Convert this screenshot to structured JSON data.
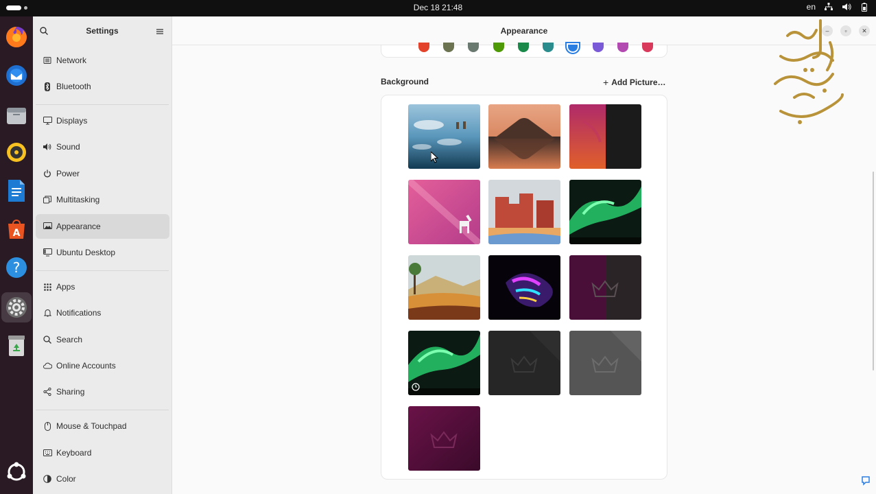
{
  "topbar": {
    "clock": "Dec 18  21:48",
    "language": "en"
  },
  "dock": {
    "apps": [
      "firefox-icon",
      "thunderbird-icon",
      "files-icon",
      "rhythmbox-icon",
      "writer-icon",
      "app-center-icon",
      "help-icon",
      "settings-icon",
      "trash-icon",
      "show-apps-icon"
    ]
  },
  "sidebar": {
    "title": "Settings",
    "items": [
      {
        "label": "Network",
        "icon": "network-icon"
      },
      {
        "label": "Bluetooth",
        "icon": "bluetooth-icon"
      },
      {
        "label": "Displays",
        "icon": "display-icon"
      },
      {
        "label": "Sound",
        "icon": "sound-icon"
      },
      {
        "label": "Power",
        "icon": "power-icon"
      },
      {
        "label": "Multitasking",
        "icon": "multitasking-icon"
      },
      {
        "label": "Appearance",
        "icon": "appearance-icon",
        "selected": true
      },
      {
        "label": "Ubuntu Desktop",
        "icon": "ubuntu-desktop-icon"
      },
      {
        "label": "Apps",
        "icon": "apps-icon"
      },
      {
        "label": "Notifications",
        "icon": "bell-icon"
      },
      {
        "label": "Search",
        "icon": "search-icon"
      },
      {
        "label": "Online Accounts",
        "icon": "cloud-icon"
      },
      {
        "label": "Sharing",
        "icon": "share-icon"
      },
      {
        "label": "Mouse & Touchpad",
        "icon": "mouse-icon"
      },
      {
        "label": "Keyboard",
        "icon": "keyboard-icon"
      },
      {
        "label": "Color",
        "icon": "color-icon"
      }
    ]
  },
  "main": {
    "title": "Appearance",
    "accent_colors": [
      "#e2432a",
      "#6b7351",
      "#6b7a70",
      "#4e9a06",
      "#1a8a4a",
      "#2a8c8c",
      "#2a7de1",
      "#7a5ad6",
      "#b34ab2",
      "#d93a5c"
    ],
    "selected_accent": 6,
    "background_label": "Background",
    "add_picture_label": "Add Picture…",
    "wallpapers": [
      "lake-reflection-wallpaper",
      "mountain-sunset-wallpaper",
      "red-dark-split-wallpaper",
      "pink-zebra-wallpaper",
      "desert-canyon-wallpaper",
      "aurora-wallpaper",
      "countryside-wallpaper",
      "glass-crystal-wallpaper",
      "dark-purple-crown-wallpaper",
      "aurora-timed-wallpaper",
      "dark-crown-wallpaper",
      "gray-crown-wallpaper",
      "purple-crown-wallpaper"
    ]
  }
}
